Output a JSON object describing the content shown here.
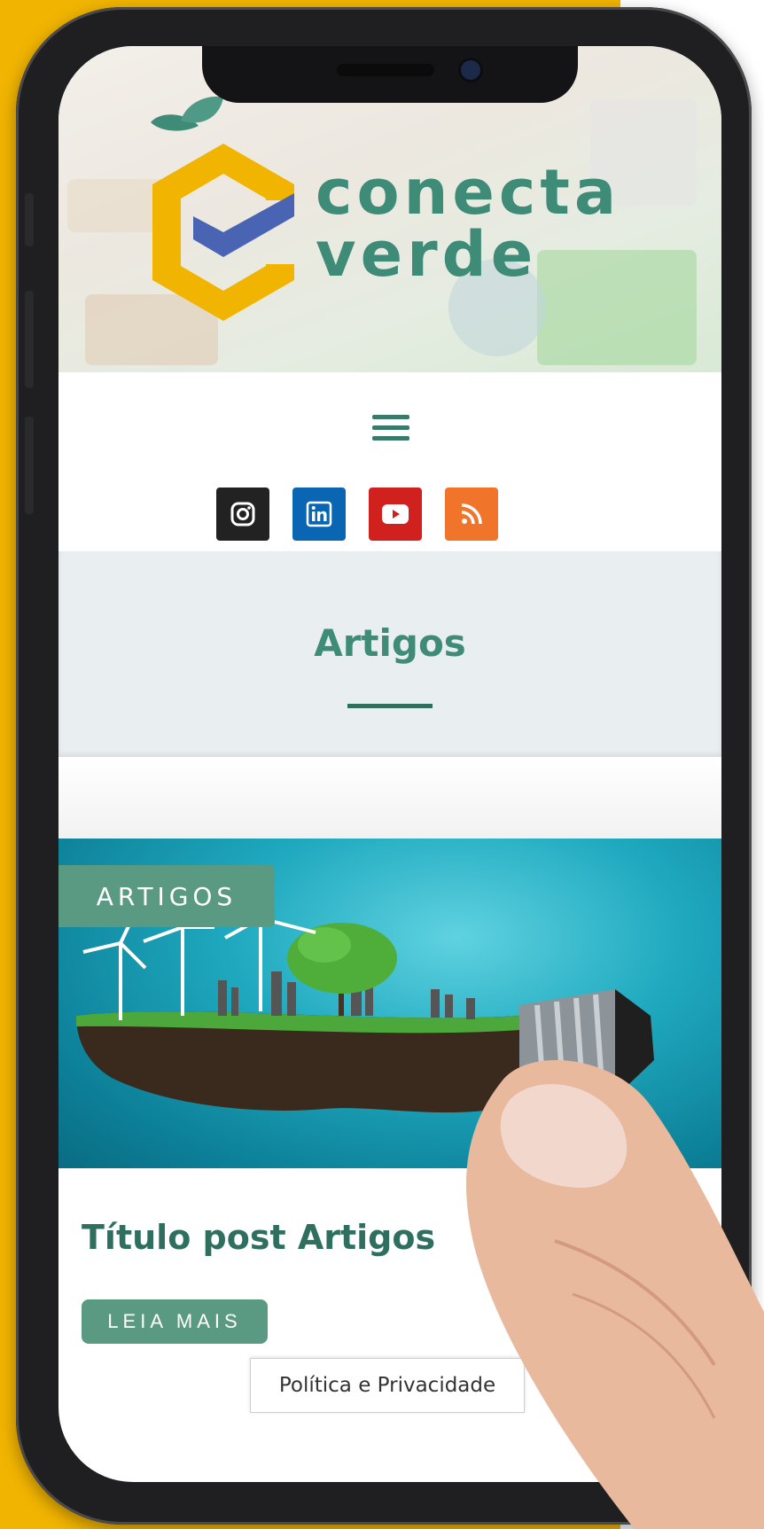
{
  "brand": {
    "line1": "conecta",
    "line2": "verde"
  },
  "nav": {
    "menu_icon": "hamburger-menu-icon",
    "social": [
      {
        "name": "instagram",
        "icon": "instagram-icon",
        "color": "#222222"
      },
      {
        "name": "linkedin",
        "icon": "linkedin-icon",
        "color": "#0a66b2"
      },
      {
        "name": "youtube",
        "icon": "youtube-icon",
        "color": "#d0211f"
      },
      {
        "name": "rss",
        "icon": "rss-icon",
        "color": "#f0742a"
      }
    ]
  },
  "page": {
    "title": "Artigos"
  },
  "post": {
    "category_badge": "ARTIGOS",
    "title": "Título post Artigos",
    "read_more_label": "LEIA MAIS"
  },
  "footer": {
    "policy_label": "Política e Privacidade"
  },
  "colors": {
    "accent": "#3e8b78",
    "badge": "#5b9a82",
    "brand_yellow": "#f1b400",
    "brand_blue": "#4a64b4"
  }
}
